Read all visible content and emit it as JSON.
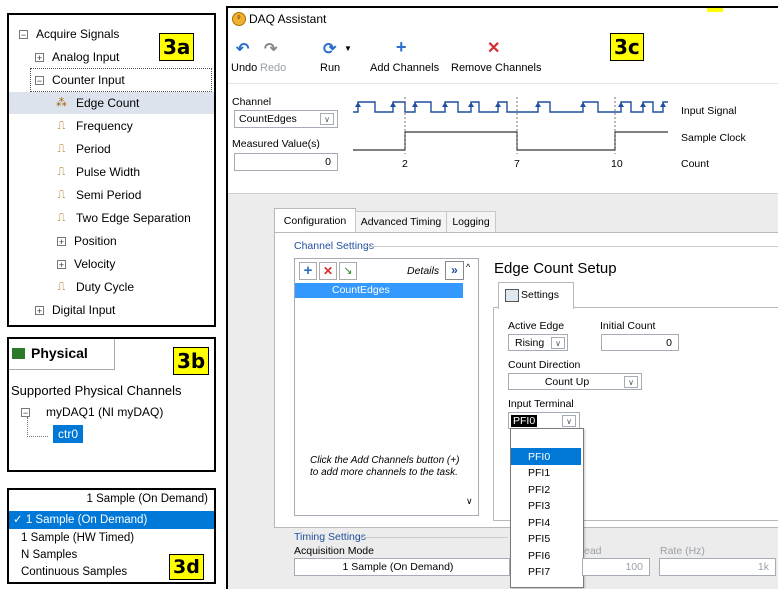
{
  "labels": {
    "a": "3a",
    "b": "3b",
    "c": "3c",
    "d": "3d"
  },
  "tree": {
    "root": "Acquire Signals",
    "analog": "Analog Input",
    "counter": "Counter Input",
    "items": [
      "Edge Count",
      "Frequency",
      "Period",
      "Pulse Width",
      "Semi Period",
      "Two Edge Separation"
    ],
    "position": "Position",
    "velocity": "Velocity",
    "duty": "Duty Cycle",
    "digital": "Digital Input"
  },
  "physical": {
    "tab": "Physical",
    "heading": "Supported Physical Channels",
    "device": "myDAQ1  (NI myDAQ)",
    "channel": "ctr0"
  },
  "modes": {
    "current": "1 Sample (On Demand)",
    "options": [
      "1 Sample (On Demand)",
      "1 Sample (HW Timed)",
      "N Samples",
      "Continuous Samples"
    ]
  },
  "daq": {
    "title": "DAQ Assistant",
    "toolbar": {
      "undo": "Undo",
      "redo": "Redo",
      "run": "Run",
      "add": "Add Channels",
      "remove": "Remove Channels"
    },
    "channel_label": "Channel",
    "channel_value": "CountEdges",
    "measured_label": "Measured Value(s)",
    "measured_value": "0",
    "counts": [
      "2",
      "7",
      "10"
    ],
    "legend": {
      "input": "Input Signal",
      "clock": "Sample Clock",
      "count": "Count"
    },
    "tabs": [
      "Configuration",
      "Advanced Timing",
      "Logging"
    ],
    "channel_settings": "Channel Settings",
    "details": "Details",
    "list_item": "CountEdges",
    "hint": "Click the Add Channels button (+) to add more channels to the task.",
    "setup_title": "Edge Count Setup",
    "settings_tab": "Settings",
    "active_edge_label": "Active Edge",
    "active_edge": "Rising",
    "initial_count_label": "Initial Count",
    "initial_count": "0",
    "direction_label": "Count Direction",
    "direction": "Count Up",
    "terminal_label": "Input Terminal",
    "terminal": "PFI0",
    "terminal_options": [
      "PFI0",
      "PFI1",
      "PFI2",
      "PFI3",
      "PFI4",
      "PFI5",
      "PFI6",
      "PFI7"
    ],
    "timing_settings": "Timing Settings",
    "acq_mode_label": "Acquisition Mode",
    "acq_mode": "1 Sample (On Demand)",
    "read_label": "ead",
    "read_value": "100",
    "rate_label": "Rate (Hz)",
    "rate_value": "1k"
  },
  "colors": {
    "highlight": "#3399ff",
    "tag": "#ffff00",
    "selection": "#0078d7"
  }
}
